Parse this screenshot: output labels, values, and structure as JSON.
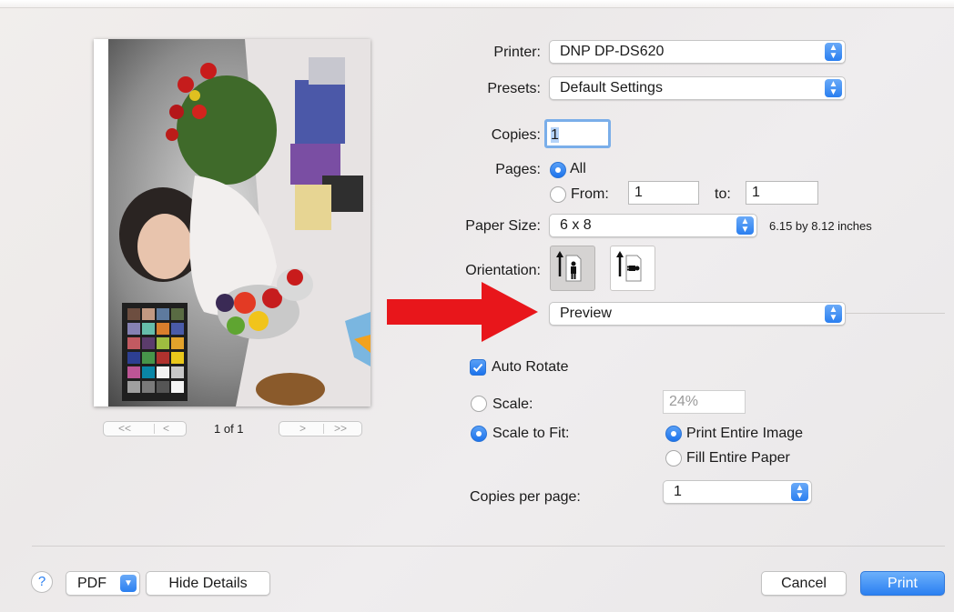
{
  "printer": {
    "label": "Printer:",
    "value": "DNP DP-DS620"
  },
  "presets": {
    "label": "Presets:",
    "value": "Default Settings"
  },
  "copies": {
    "label": "Copies:",
    "value": "1"
  },
  "pages": {
    "label": "Pages:",
    "all_label": "All",
    "from_label": "From:",
    "from_value": "1",
    "to_label": "to:",
    "to_value": "1"
  },
  "paper_size": {
    "label": "Paper Size:",
    "value": "6 x 8",
    "dimensions": "6.15 by 8.12 inches"
  },
  "orientation": {
    "label": "Orientation:",
    "selected": "portrait"
  },
  "section_menu": {
    "value": "Preview"
  },
  "preview_options": {
    "auto_rotate_label": "Auto Rotate",
    "auto_rotate_checked": true,
    "scale_label": "Scale:",
    "scale_value": "24%",
    "scale_to_fit_label": "Scale to Fit:",
    "print_entire_image_label": "Print Entire Image",
    "fill_entire_paper_label": "Fill Entire Paper",
    "copies_per_page_label": "Copies per page:",
    "copies_per_page_value": "1"
  },
  "preview_nav": {
    "first": "<<",
    "prev": "<",
    "page_indicator": "1 of 1",
    "next": ">",
    "last": ">>"
  },
  "footer": {
    "help": "?",
    "pdf": "PDF",
    "hide_details": "Hide Details",
    "cancel": "Cancel",
    "print": "Print"
  },
  "colors": {
    "accent": "#2a7ff0",
    "arrow": "#e8161b"
  },
  "icons": {
    "stepper": "updown-chevron-icon",
    "checkmark": "checkmark-icon",
    "arrow": "red-arrow-icon"
  }
}
